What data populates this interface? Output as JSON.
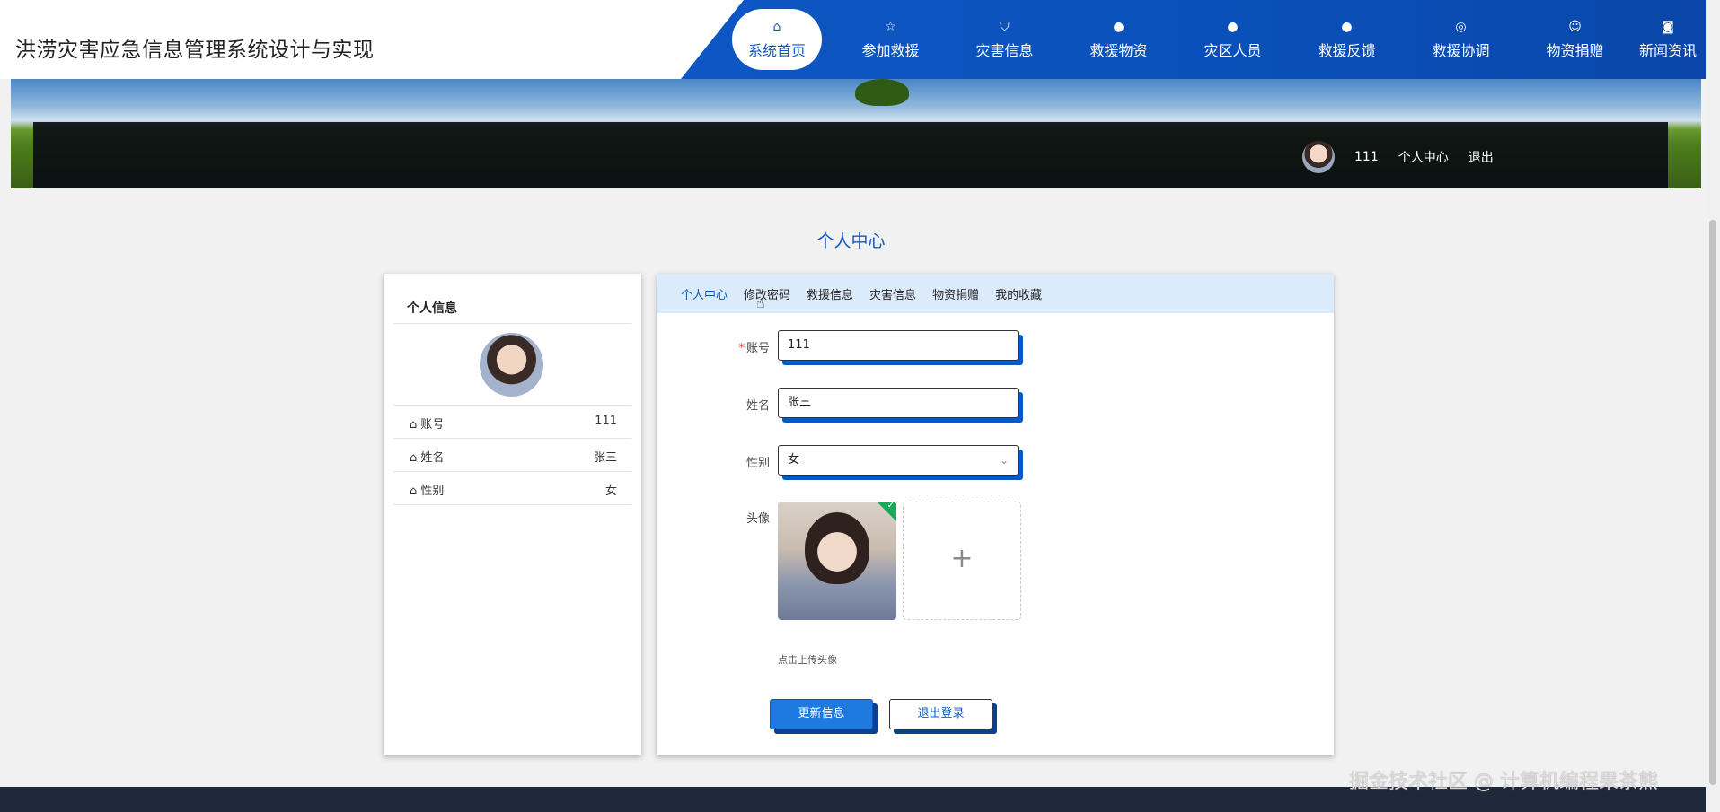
{
  "app": {
    "title": "洪涝灾害应急信息管理系统设计与实现"
  },
  "nav": {
    "items": [
      {
        "label": "系统首页",
        "icon": "home-icon",
        "glyph": "⌂"
      },
      {
        "label": "参加救援",
        "icon": "star-icon",
        "glyph": "☆"
      },
      {
        "label": "灾害信息",
        "icon": "bag-icon",
        "glyph": "⛉"
      },
      {
        "label": "救援物资",
        "icon": "alert-icon",
        "glyph": "●"
      },
      {
        "label": "灾区人员",
        "icon": "question-icon",
        "glyph": "●"
      },
      {
        "label": "救援反馈",
        "icon": "info-icon",
        "glyph": "●"
      },
      {
        "label": "救援协调",
        "icon": "globe-icon",
        "glyph": "◎"
      },
      {
        "label": "物资捐赠",
        "icon": "smile-icon",
        "glyph": "☺"
      },
      {
        "label": "新闻资讯",
        "icon": "camera-icon",
        "glyph": "◙"
      }
    ]
  },
  "user_bar": {
    "username": "111",
    "center_label": "个人中心",
    "logout_label": "退出"
  },
  "page": {
    "title": "个人中心"
  },
  "profile_card": {
    "title": "个人信息",
    "rows": [
      {
        "label": "账号",
        "value": "111"
      },
      {
        "label": "姓名",
        "value": "张三"
      },
      {
        "label": "性别",
        "value": "女"
      }
    ]
  },
  "tabs": [
    "个人中心",
    "修改密码",
    "救援信息",
    "灾害信息",
    "物资捐赠",
    "我的收藏"
  ],
  "form": {
    "account_label": "账号",
    "account_value": "111",
    "required_mark": "*",
    "name_label": "姓名",
    "name_value": "张三",
    "gender_label": "性别",
    "gender_value": "女",
    "avatar_label": "头像",
    "upload_plus": "+",
    "upload_hint": "点击上传头像",
    "update_button": "更新信息",
    "logout_button": "退出登录"
  },
  "watermark": "掘金技术社区 @ 计算机编程果茶熊",
  "colors": {
    "primary": "#0d57c4",
    "tab_bg": "#dcebfb",
    "page_bg": "#f1f1f1",
    "footer": "#1e2a3c"
  }
}
